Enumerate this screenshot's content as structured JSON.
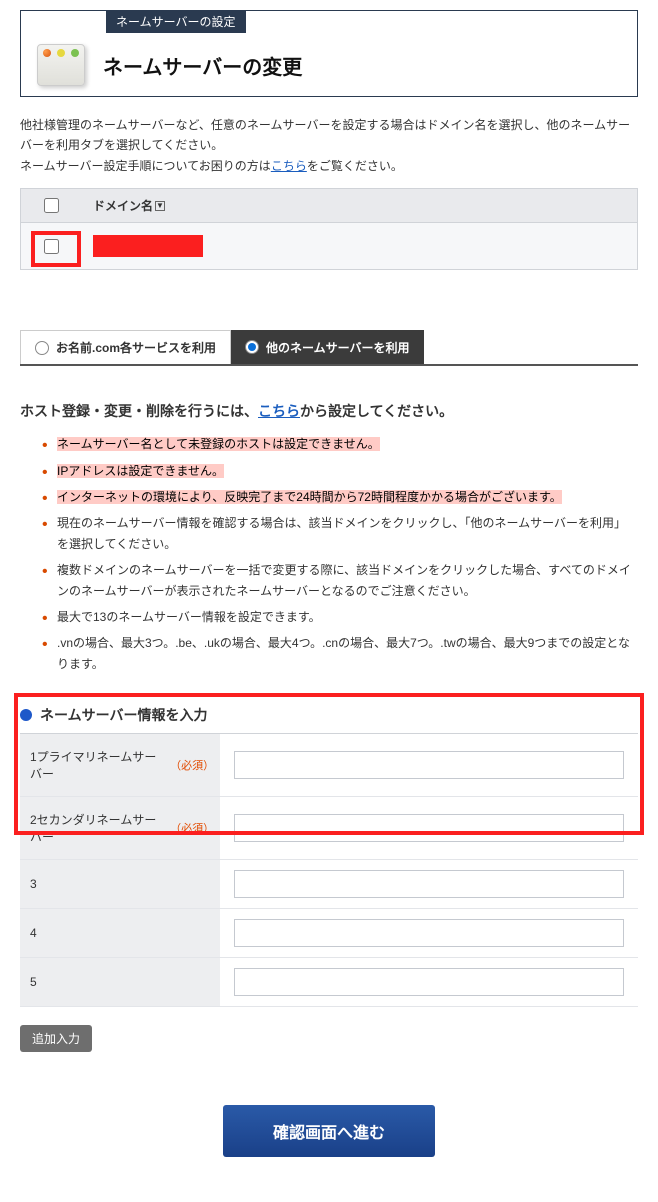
{
  "header": {
    "tab_label": "ネームサーバーの設定",
    "title": "ネームサーバーの変更"
  },
  "intro": {
    "line1": "他社様管理のネームサーバーなど、任意のネームサーバーを設定する場合はドメイン名を選択し、他のネームサーバーを利用タブを選択してください。",
    "line2_pre": "ネームサーバー設定手順についてお困りの方は",
    "line2_link": "こちら",
    "line2_post": "をご覧ください。"
  },
  "domain_table": {
    "header": "ドメイン名"
  },
  "tabs": {
    "inactive": "お名前.com各サービスを利用",
    "active": "他のネームサーバーを利用"
  },
  "host_note": {
    "pre": "ホスト登録・変更・削除を行うには、",
    "link": "こちら",
    "post": "から設定してください。"
  },
  "notes": [
    {
      "hl": true,
      "text": "ネームサーバー名として未登録のホストは設定できません。"
    },
    {
      "hl": true,
      "text": "IPアドレスは設定できません。"
    },
    {
      "hl": true,
      "text": "インターネットの環境により、反映完了まで24時間から72時間程度かかる場合がございます。"
    },
    {
      "hl": false,
      "text": "現在のネームサーバー情報を確認する場合は、該当ドメインをクリックし、「他のネームサーバーを利用」を選択してください。"
    },
    {
      "hl": false,
      "text": "複数ドメインのネームサーバーを一括で変更する際に、該当ドメインをクリックした場合、すべてのドメインのネームサーバーが表示されたネームサーバーとなるのでご注意ください。"
    },
    {
      "hl": false,
      "text": "最大で13のネームサーバー情報を設定できます。"
    },
    {
      "hl": false,
      "text": ".vnの場合、最大3つ。.be、.ukの場合、最大4つ。.cnの場合、最大7つ。.twの場合、最大9つまでの設定となります。"
    }
  ],
  "ns": {
    "section_title": "ネームサーバー情報を入力",
    "required": "（必須）",
    "rows": [
      {
        "label": "1プライマリネームサーバー",
        "required": true
      },
      {
        "label": "2セカンダリネームサーバー",
        "required": true
      },
      {
        "label": "3",
        "required": false
      },
      {
        "label": "4",
        "required": false
      },
      {
        "label": "5",
        "required": false
      }
    ],
    "add_button": "追加入力"
  },
  "proceed_button": "確認画面へ進む"
}
